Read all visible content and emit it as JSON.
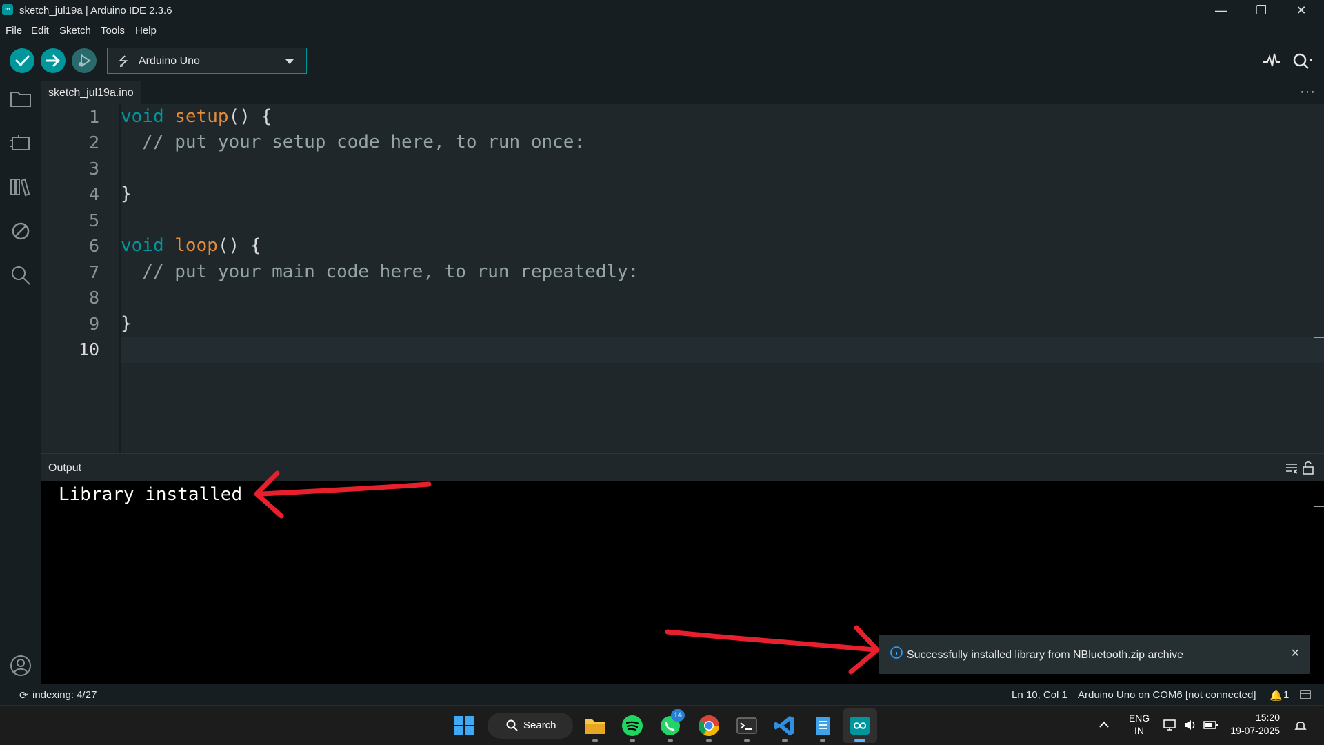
{
  "window": {
    "title": "sketch_jul19a | Arduino IDE 2.3.6",
    "minimize": "—",
    "restore": "❐",
    "close": "✕"
  },
  "menu": [
    "File",
    "Edit",
    "Sketch",
    "Tools",
    "Help"
  ],
  "toolbar": {
    "verify_icon": "check-icon",
    "upload_icon": "arrow-right-icon",
    "debug_icon": "debug-icon",
    "board": "Arduino Uno",
    "serial_plotter_icon": "pulse-icon",
    "serial_monitor_icon": "magnifier-icon"
  },
  "sidebar": [
    "folder-icon",
    "board-manager-icon",
    "library-icon",
    "debug-disabled-icon",
    "search-icon",
    "account-icon"
  ],
  "editor": {
    "tab": "sketch_jul19a.ino",
    "more": "···",
    "lines": [
      "1",
      "2",
      "3",
      "4",
      "5",
      "6",
      "7",
      "8",
      "9",
      "10"
    ],
    "code": {
      "l1_kw": "void",
      "l1_fn": "setup",
      "l1_rest": "() {",
      "l2": "  // put your setup code here, to run once:",
      "l4": "}",
      "l6_kw": "void",
      "l6_fn": "loop",
      "l6_rest": "() {",
      "l7": "  // put your main code here, to run repeatedly:",
      "l9": "}"
    }
  },
  "output": {
    "tab": "Output",
    "text": "Library installed"
  },
  "notification": {
    "text": "Successfully installed library from NBluetooth.zip archive",
    "close": "✕"
  },
  "status": {
    "indexing": "indexing: 4/27",
    "position": "Ln 10, Col 1",
    "board": "Arduino Uno on COM6 [not connected]",
    "notifications": "1"
  },
  "taskbar": {
    "search": "Search",
    "whatsapp_badge": "14",
    "language_1": "ENG",
    "language_2": "IN",
    "time": "15:20",
    "date": "19-07-2025"
  },
  "colors": {
    "accent": "#00979c",
    "annotation": "#e8202e"
  }
}
